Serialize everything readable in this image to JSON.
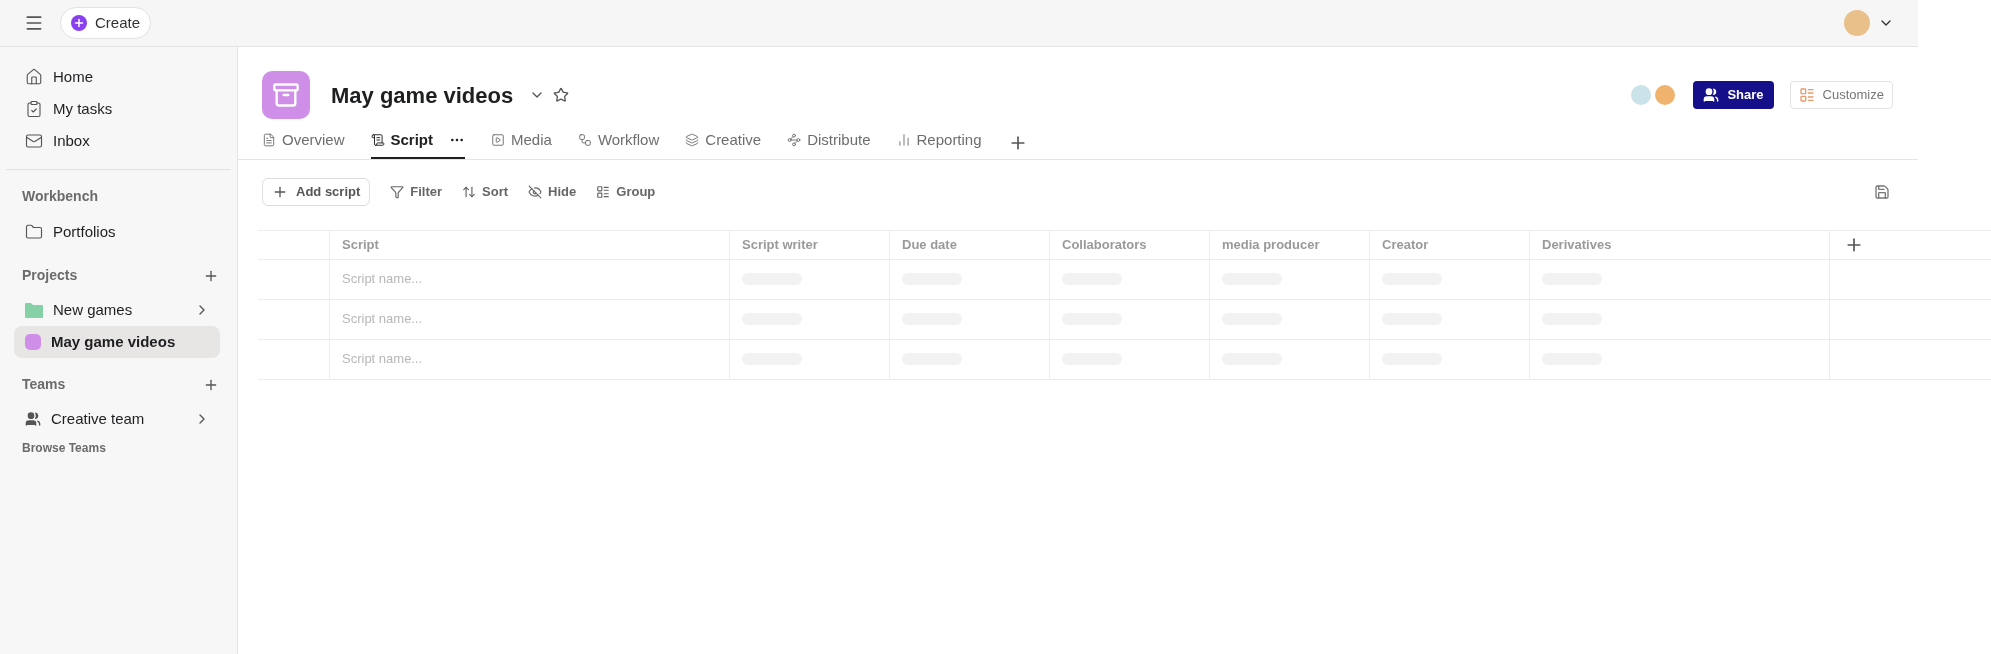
{
  "topbar": {
    "create_label": "Create"
  },
  "sidebar": {
    "nav": [
      {
        "label": "Home",
        "kind": "home"
      },
      {
        "label": "My tasks",
        "kind": "tasks"
      },
      {
        "label": "Inbox",
        "kind": "inbox"
      }
    ],
    "workbench": {
      "heading": "Workbench",
      "items": [
        {
          "label": "Portfolios"
        }
      ]
    },
    "projects": {
      "heading": "Projects",
      "items": [
        {
          "label": "New games",
          "kind": "folder",
          "color": "#86d0a8",
          "selected": false,
          "expandable": true
        },
        {
          "label": "May game videos",
          "kind": "dot",
          "color": "#cf8fe8",
          "selected": true,
          "expandable": false
        }
      ]
    },
    "teams": {
      "heading": "Teams",
      "items": [
        {
          "label": "Creative team",
          "expandable": true
        }
      ]
    },
    "browse_label": "Browse Teams"
  },
  "project": {
    "title": "May game videos",
    "tabs": [
      {
        "label": "Overview",
        "kind": "overview",
        "selected": false
      },
      {
        "label": "Script",
        "kind": "script",
        "selected": true
      },
      {
        "label": "Media",
        "kind": "media",
        "selected": false
      },
      {
        "label": "Workflow",
        "kind": "workflow",
        "selected": false
      },
      {
        "label": "Creative",
        "kind": "creative",
        "selected": false
      },
      {
        "label": "Distribute",
        "kind": "distribute",
        "selected": false
      },
      {
        "label": "Reporting",
        "kind": "reporting",
        "selected": false
      }
    ],
    "share_label": "Share",
    "customize_label": "Customize"
  },
  "toolbar": {
    "add_label": "Add script",
    "actions": [
      {
        "label": "Filter",
        "kind": "filter"
      },
      {
        "label": "Sort",
        "kind": "sort"
      },
      {
        "label": "Hide",
        "kind": "hide"
      },
      {
        "label": "Group",
        "kind": "group"
      }
    ]
  },
  "table": {
    "columns": [
      "Script",
      "Script writer",
      "Due date",
      "Collaborators",
      "media producer",
      "Creator",
      "Derivatives"
    ],
    "rows": [
      {
        "placeholder": "Script name..."
      },
      {
        "placeholder": "Script name..."
      },
      {
        "placeholder": "Script name..."
      }
    ]
  }
}
